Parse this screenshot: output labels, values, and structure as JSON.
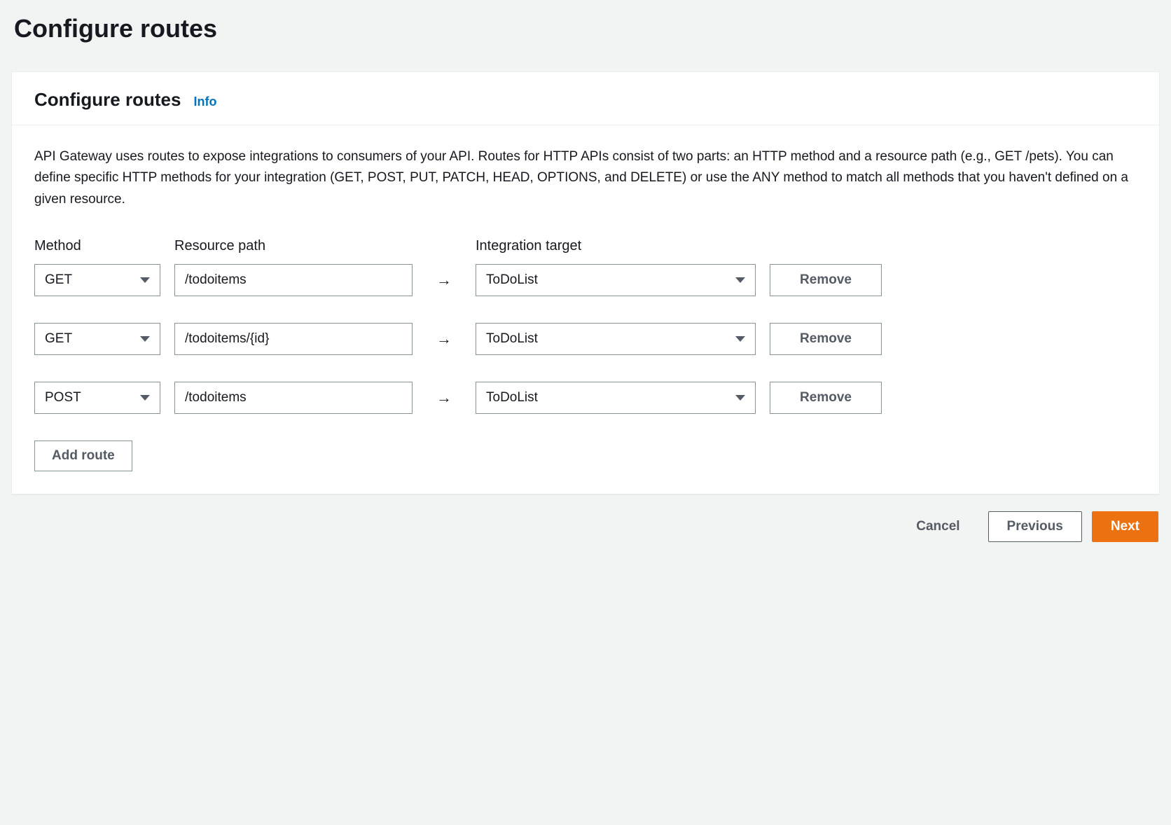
{
  "page": {
    "title": "Configure routes"
  },
  "card": {
    "title": "Configure routes",
    "info_label": "Info",
    "description": "API Gateway uses routes to expose integrations to consumers of your API. Routes for HTTP APIs consist of two parts: an HTTP method and a resource path (e.g., GET /pets). You can define specific HTTP methods for your integration (GET, POST, PUT, PATCH, HEAD, OPTIONS, and DELETE) or use the ANY method to match all methods that you haven't defined on a given resource."
  },
  "columns": {
    "method": "Method",
    "resource_path": "Resource path",
    "integration_target": "Integration target"
  },
  "routes": [
    {
      "method": "GET",
      "path": "/todoitems",
      "target": "ToDoList",
      "remove_label": "Remove"
    },
    {
      "method": "GET",
      "path": "/todoitems/{id}",
      "target": "ToDoList",
      "remove_label": "Remove"
    },
    {
      "method": "POST",
      "path": "/todoitems",
      "target": "ToDoList",
      "remove_label": "Remove"
    }
  ],
  "arrow": "→",
  "add_route_label": "Add route",
  "actions": {
    "cancel": "Cancel",
    "previous": "Previous",
    "next": "Next"
  }
}
